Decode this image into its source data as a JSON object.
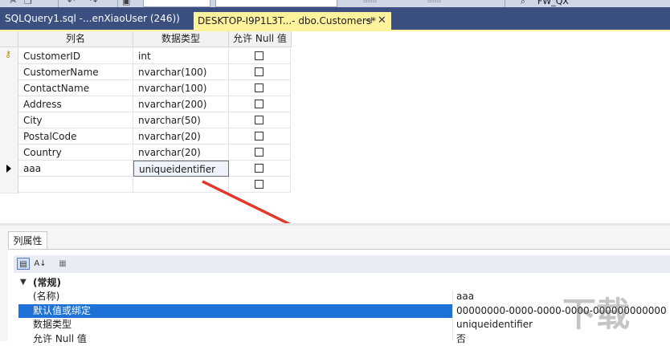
{
  "tabs": {
    "query": "SQLQuery1.sql -...enXiaoUser (246))",
    "designer": "DESKTOP-I9P1L3T...- dbo.Customers*",
    "pin_icon": "pin-icon",
    "close_icon": "close-icon"
  },
  "toolbar": {
    "search_value": "FW_QX"
  },
  "grid": {
    "headers": [
      "列名",
      "数据类型",
      "允许 Null 值"
    ],
    "rows": [
      {
        "name": "CustomerID",
        "type": "int",
        "allow_null": false,
        "primary_key": true
      },
      {
        "name": "CustomerName",
        "type": "nvarchar(100)",
        "allow_null": false
      },
      {
        "name": "ContactName",
        "type": "nvarchar(100)",
        "allow_null": false
      },
      {
        "name": "Address",
        "type": "nvarchar(200)",
        "allow_null": false
      },
      {
        "name": "City",
        "type": "nvarchar(50)",
        "allow_null": false
      },
      {
        "name": "PostalCode",
        "type": "nvarchar(20)",
        "allow_null": false
      },
      {
        "name": "Country",
        "type": "nvarchar(20)",
        "allow_null": false
      },
      {
        "name": "aaa",
        "type": "uniqueidentifier",
        "allow_null": false,
        "current": true
      },
      {
        "name": "",
        "type": "",
        "allow_null": false
      }
    ]
  },
  "properties": {
    "tab_label": "列属性",
    "category": "(常规)",
    "rows": [
      {
        "name": "(名称)",
        "value": "aaa"
      },
      {
        "name": "默认值或绑定",
        "value": "00000000-0000-0000-0000-000000000000",
        "selected": true
      },
      {
        "name": "数据类型",
        "value": "uniqueidentifier"
      },
      {
        "name": "允许 Null 值",
        "value": "否"
      }
    ]
  },
  "annotation": {
    "arrow_color": "#e0392e"
  },
  "colors": {
    "tab_strip": "#3b4f81",
    "active_tab": "#fff29d",
    "selection": "#1e72d7"
  }
}
